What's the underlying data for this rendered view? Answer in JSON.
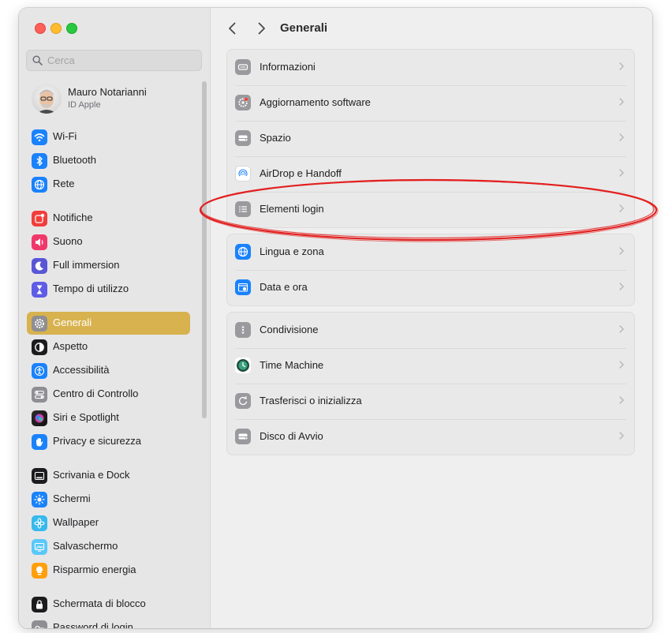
{
  "sidebar": {
    "search_placeholder": "Cerca",
    "account": {
      "name": "Mauro Notarianni",
      "subtitle": "ID Apple"
    },
    "items": [
      {
        "label": "Wi-Fi",
        "color": "#1a82fb"
      },
      {
        "label": "Bluetooth",
        "color": "#1a82fb"
      },
      {
        "label": "Rete",
        "color": "#1a82fb"
      },
      {
        "label": "Notifiche",
        "color": "#f23d3b"
      },
      {
        "label": "Suono",
        "color": "#f0386b"
      },
      {
        "label": "Full immersion",
        "color": "#5856d6"
      },
      {
        "label": "Tempo di utilizzo",
        "color": "#5e5ce6"
      },
      {
        "label": "Generali",
        "color": "#8e8e93",
        "selected": true
      },
      {
        "label": "Aspetto",
        "color": "#1c1c1e"
      },
      {
        "label": "Accessibilità",
        "color": "#1a82fb"
      },
      {
        "label": "Centro di Controllo",
        "color": "#8e8e93"
      },
      {
        "label": "Siri e Spotlight",
        "color": "#b03ad9"
      },
      {
        "label": "Privacy e sicurezza",
        "color": "#1a82fb"
      },
      {
        "label": "Scrivania e Dock",
        "color": "#1c1c1e"
      },
      {
        "label": "Schermi",
        "color": "#1a82fb"
      },
      {
        "label": "Wallpaper",
        "color": "#38b9ec"
      },
      {
        "label": "Salvaschermo",
        "color": "#5ac8fa"
      },
      {
        "label": "Risparmio energia",
        "color": "#ff9f0a"
      },
      {
        "label": "Schermata di blocco",
        "color": "#1c1c1e"
      },
      {
        "label": "Password di login",
        "color": "#8e8e93"
      }
    ]
  },
  "header": {
    "title": "Generali"
  },
  "groups": [
    [
      {
        "label": "Informazioni",
        "icon": "info-icon"
      },
      {
        "label": "Aggiornamento software",
        "icon": "gear-badge-icon"
      },
      {
        "label": "Spazio",
        "icon": "storage-icon"
      },
      {
        "label": "AirDrop e Handoff",
        "icon": "airdrop-icon"
      },
      {
        "label": "Elementi login",
        "icon": "list-icon"
      }
    ],
    [
      {
        "label": "Lingua e zona",
        "icon": "globe-icon"
      },
      {
        "label": "Data e ora",
        "icon": "calendar-clock-icon"
      }
    ],
    [
      {
        "label": "Condivisione",
        "icon": "sharing-icon"
      },
      {
        "label": "Time Machine",
        "icon": "time-machine-icon"
      },
      {
        "label": "Trasferisci o inizializza",
        "icon": "reset-icon"
      },
      {
        "label": "Disco di Avvio",
        "icon": "disk-icon"
      }
    ]
  ],
  "colors": {
    "accent": "#d7b24f",
    "annotation": "#e32020"
  }
}
